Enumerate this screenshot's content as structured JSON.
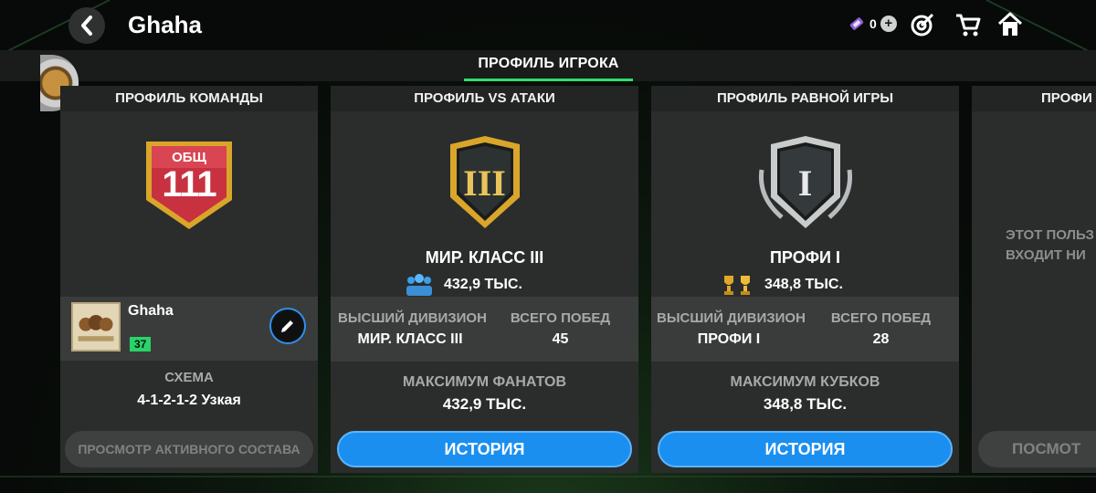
{
  "header": {
    "title": "Ghaha",
    "back_icon": "chevron-left-icon",
    "currency_value": "0",
    "icons": [
      "ticket-icon",
      "plus-icon",
      "target-icon",
      "cart-icon",
      "home-icon"
    ]
  },
  "tabs": {
    "active_label": "ПРОФИЛЬ ИГРОКА"
  },
  "team_card": {
    "header": "ПРОФИЛЬ КОМАНДЫ",
    "ovr_label": "ОБЩ",
    "ovr_value": "111",
    "club_name": "Ghaha",
    "level": "37",
    "formation_label": "СХЕМА",
    "formation_value": "4-1-2-1-2 Узкая",
    "button_label": "ПРОСМОТР АКТИВНОГО СОСТАВА"
  },
  "vs_attack_card": {
    "header": "ПРОФИЛЬ VS АТАКИ",
    "rank_numeral": "III",
    "rank_title": "МИР. КЛАСС III",
    "rank_points": "432,9 ТЫС.",
    "highest_division_label": "ВЫСШИЙ ДИВИЗИОН",
    "highest_division_value": "МИР. КЛАСС III",
    "total_wins_label": "ВСЕГО ПОБЕД",
    "total_wins_value": "45",
    "max_label": "МАКСИМУМ ФАНАТОВ",
    "max_value": "432,9 ТЫС.",
    "button_label": "ИСТОРИЯ"
  },
  "h2h_card": {
    "header": "ПРОФИЛЬ РАВНОЙ ИГРЫ",
    "rank_numeral": "I",
    "rank_title": "ПРОФИ I",
    "rank_points": "348,8 ТЫС.",
    "highest_division_label": "ВЫСШИЙ ДИВИЗИОН",
    "highest_division_value": "ПРОФИ I",
    "total_wins_label": "ВСЕГО ПОБЕД",
    "total_wins_value": "28",
    "max_label": "МАКСИМУМ КУБКОВ",
    "max_value": "348,8 ТЫС.",
    "button_label": "ИСТОРИЯ"
  },
  "partial_card": {
    "header": "ПРОФИ",
    "text_line1": "ЭТОТ ПОЛЬЗ",
    "text_line2": "ВХОДИТ НИ",
    "button_label": "ПОСМОТ"
  },
  "colors": {
    "accent_green": "#2ee06b",
    "button_blue": "#1a8ff0",
    "gold": "#d9a62a",
    "red_badge": "#c8313f"
  }
}
